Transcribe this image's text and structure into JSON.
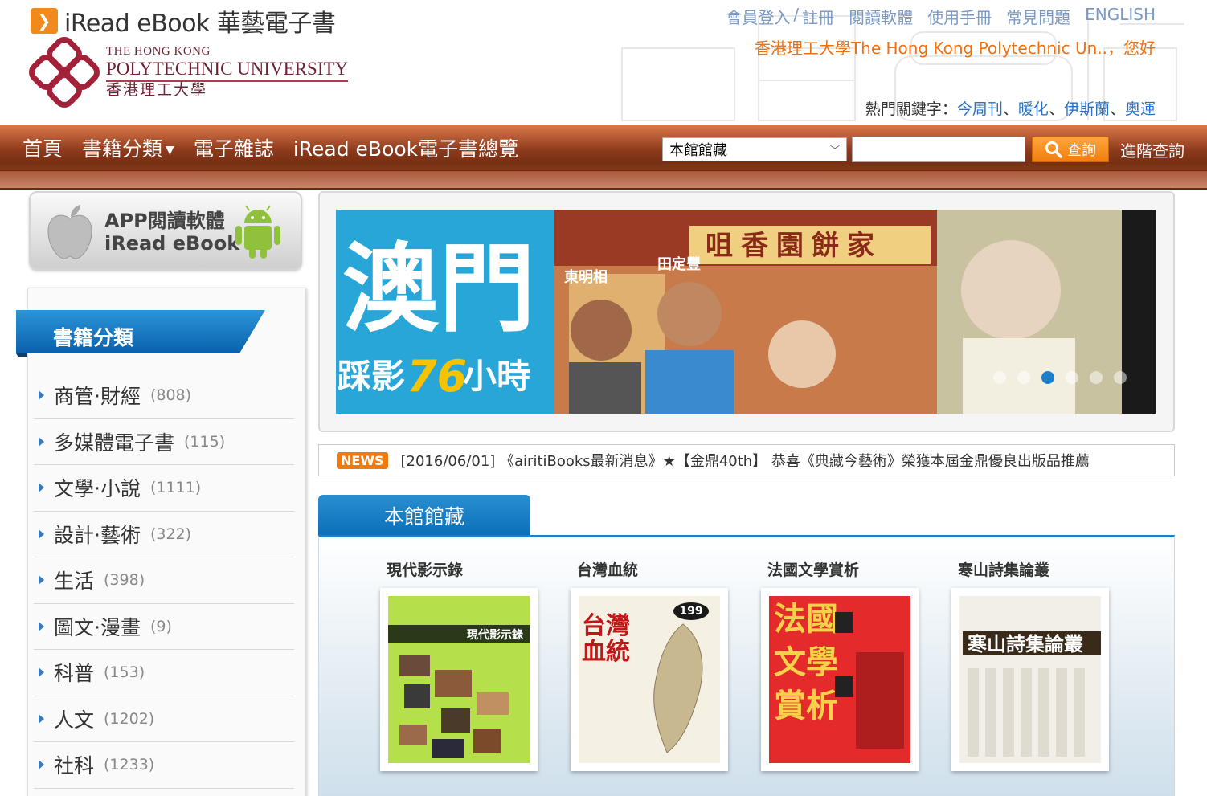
{
  "brand": {
    "name": "iRead eBook 華藝電子書"
  },
  "university": {
    "line1": "THE HONG KONG",
    "line2": "POLYTECHNIC UNIVERSITY",
    "line3": "香港理工大學"
  },
  "top_links": [
    "會員登入",
    "/",
    "註冊",
    "閱讀軟體",
    "使用手冊",
    "常見問題",
    "ENGLISH"
  ],
  "greeting": "香港理工大學The Hong Kong Polytechnic Un..，您好",
  "hot_keywords": {
    "label": "熱門關鍵字：",
    "items": [
      "今周刊",
      "暖化",
      "伊斯蘭",
      "奧運"
    ],
    "sep": "、"
  },
  "nav": {
    "home": "首頁",
    "categories": "書籍分類",
    "magazines": "電子雜誌",
    "overview": "iRead eBook電子書總覽"
  },
  "search": {
    "scope": "本館館藏",
    "button": "查詢",
    "advanced": "進階查詢",
    "placeholder": ""
  },
  "app_banner": {
    "line1": "APP閱讀軟體",
    "line2": "iRead eBook"
  },
  "category_panel": {
    "title": "書籍分類",
    "items": [
      {
        "label": "商管‧財經",
        "count": "(808)"
      },
      {
        "label": "多媒體電子書",
        "count": "(115)"
      },
      {
        "label": "文學‧小說",
        "count": "(1111)"
      },
      {
        "label": "設計‧藝術",
        "count": "(322)"
      },
      {
        "label": "生活",
        "count": "(398)"
      },
      {
        "label": "圖文‧漫畫",
        "count": "(9)"
      },
      {
        "label": "科普",
        "count": "(153)"
      },
      {
        "label": "人文",
        "count": "(1202)"
      },
      {
        "label": "社科",
        "count": "(1233)"
      }
    ]
  },
  "slider": {
    "big_text": "澳門",
    "sub_text": "踩影",
    "number": "76",
    "sub_tail": "小時",
    "name1": "東明相",
    "name2": "田定豐",
    "sign": "咀香園餅家",
    "dots": 6,
    "active_dot": 3
  },
  "news": {
    "badge": "NEWS",
    "text": "[2016/06/01] 《airitiBooks最新消息》★【金鼎40th】 恭喜《典藏今藝術》榮獲本屆金鼎優良出版品推薦"
  },
  "library": {
    "tab": "本館館藏",
    "books": [
      {
        "title": "現代影示錄",
        "cover_title": "現代影示錄",
        "color": "#b6e04a"
      },
      {
        "title": "台灣血統",
        "cover_title": "台灣血統",
        "color": "#f4f0e4"
      },
      {
        "title": "法國文學賞析",
        "cover_title": "法國文學賞析",
        "color": "#e42a2a"
      },
      {
        "title": "寒山詩集論叢",
        "cover_title": "寒山詩集論叢",
        "color": "#f2efe8"
      }
    ]
  }
}
